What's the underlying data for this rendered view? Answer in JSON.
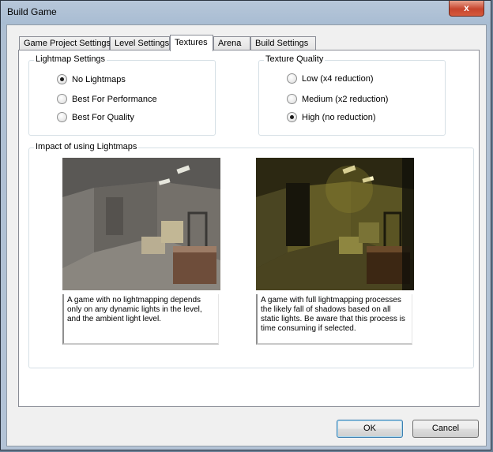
{
  "window": {
    "title": "Build Game",
    "close_glyph": "x"
  },
  "tabs": [
    {
      "label": "Game Project Settings",
      "active": false
    },
    {
      "label": "Level Settings",
      "active": false
    },
    {
      "label": "Textures",
      "active": true
    },
    {
      "label": "Arena",
      "active": false
    },
    {
      "label": "Build Settings",
      "active": false
    }
  ],
  "lightmap": {
    "title": "Lightmap Settings",
    "options": [
      {
        "label": "No Lightmaps",
        "checked": true
      },
      {
        "label": "Best For Performance",
        "checked": false
      },
      {
        "label": "Best For Quality",
        "checked": false
      }
    ]
  },
  "texture_quality": {
    "title": "Texture Quality",
    "options": [
      {
        "label": "Low (x4 reduction)",
        "checked": false
      },
      {
        "label": "Medium (x2 reduction)",
        "checked": false
      },
      {
        "label": "High (no reduction)",
        "checked": true
      }
    ]
  },
  "impact": {
    "title": "Impact of using Lightmaps",
    "left_caption": "A game with no lightmapping depends only on any dynamic lights in the level, and the ambient light level.",
    "right_caption": "A game with full lightmapping processes the likely fall of shadows based on all static lights. Be aware that this process is time consuming if selected."
  },
  "buttons": {
    "ok": "OK",
    "cancel": "Cancel"
  }
}
